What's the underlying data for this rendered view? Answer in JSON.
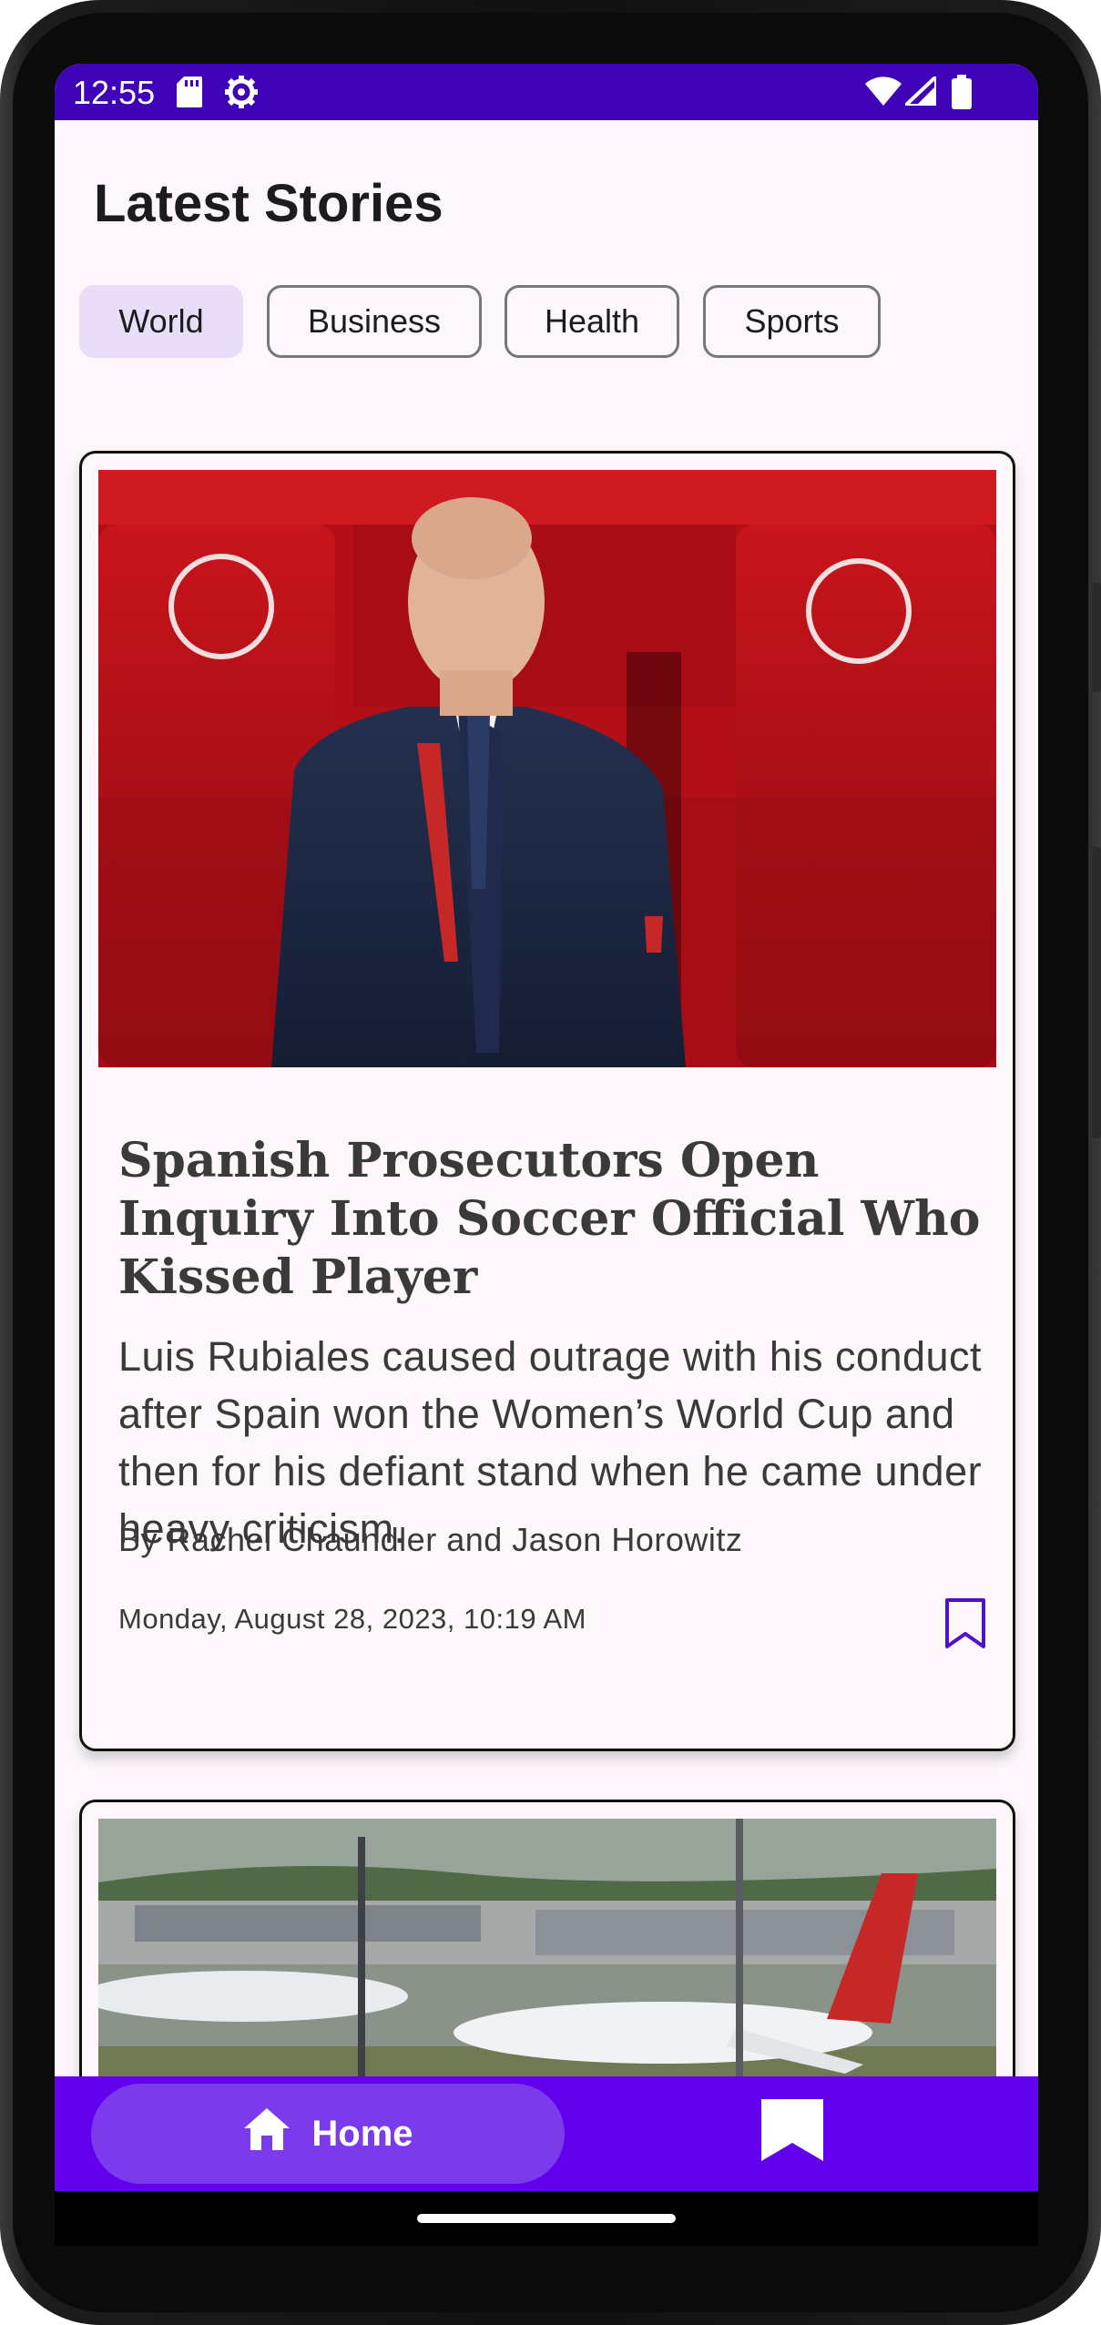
{
  "status": {
    "time": "12:55",
    "icons": [
      "sd-card-icon",
      "gear-icon",
      "wifi-icon",
      "signal-icon",
      "battery-icon"
    ]
  },
  "page": {
    "title": "Latest Stories"
  },
  "chips": [
    {
      "label": "World",
      "selected": true
    },
    {
      "label": "Business",
      "selected": false
    },
    {
      "label": "Health",
      "selected": false
    },
    {
      "label": "Sports",
      "selected": false
    }
  ],
  "stories": [
    {
      "image": "portrait of man in suit in red stadium seats",
      "headline": "Spanish Prosecutors Open Inquiry Into Soccer Official Who Kissed Player",
      "summary": "Luis Rubiales caused outrage with his conduct after Spain won the Women’s World Cup and then for his defiant stand when he came under heavy criticism.",
      "byline": "By Rachel Chaundler and Jason Horowitz",
      "date": "Monday, August 28, 2023, 10:19 AM",
      "bookmark_icon": "bookmark-outline-icon"
    },
    {
      "image": "airport with airplanes on the tarmac"
    }
  ],
  "nav": {
    "home_label": "Home",
    "home_icon": "home-icon",
    "saved_icon": "bookmark-filled-icon"
  },
  "colors": {
    "status_bar": "#3f04b8",
    "nav_bar": "#6200ee",
    "nav_active": "#7c3aed",
    "chip_selected": "#e8def8",
    "bookmark": "#4f12c4"
  }
}
